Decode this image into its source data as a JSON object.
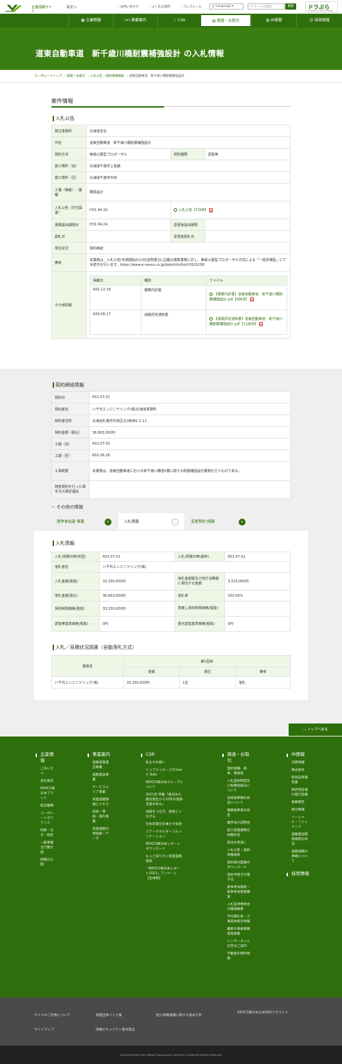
{
  "header": {
    "logo_alt": "NEXCO",
    "logo_sub": "東日本",
    "site_label": "企業情報サイト",
    "back_link": "本文へ",
    "utility": [
      {
        "label": "お問い合わせ"
      },
      {
        "label": "よくある質問"
      },
      {
        "label": "プレスルーム"
      }
    ],
    "language": "Language",
    "search_placeholder": "サイト内検索",
    "search_button": "検索",
    "drapura": "ドラぷら",
    "drapura_sub": "E-NEXCO Drive Plaza"
  },
  "nav": [
    {
      "label": "企業情報"
    },
    {
      "label": "事業案内"
    },
    {
      "label": "CSR"
    },
    {
      "label": "調達・お取引"
    },
    {
      "label": "IR情報"
    },
    {
      "label": "採用情報"
    }
  ],
  "hero_title": "道東自動車道　新千歳川橋耐震補強設計 の入札情報",
  "breadcrumb": [
    "コーポレートトップ",
    "調達・お取引",
    "入札公告・契約情報検索",
    "道東自動車道　新千歳川橋耐震補強設計"
  ],
  "section_title": "案件情報",
  "notice": {
    "title": "入札公告",
    "rows": {
      "issuer_label": "発注事務所",
      "issuer": "北海道支社",
      "subject_label": "件名",
      "subject": "道東自動車道　新千歳川橋耐震補強設計",
      "method_label": "契約方法",
      "method": "簡易公募型プロポーザル",
      "type_label": "契約種類",
      "type": "調査等",
      "place_from_label": "施工場所（自）",
      "place_from": "北海道千歳市上長都",
      "place_to_label": "施工場所（至）",
      "place_to": "北海道千歳市中央",
      "work_label": "工種（等級）／業種",
      "work": "橋梁設計",
      "pub_label": "入札公告（交付図書）",
      "pub_date": "H31.04.10",
      "pub_file": "入札公告【72KB】",
      "doc_deadline_label": "書類提出期限日",
      "doc_deadline": "H31.04.24",
      "change_submit_label": "変更後提出期限",
      "change_submit": "",
      "open_label": "開札日",
      "open": "",
      "change_open_label": "変更後開札日",
      "change_open": "",
      "status_label": "現在状況",
      "status": "契約締結",
      "remarks_label": "備考",
      "remarks": "本業務は、入札公告(手続開始の公示[説明書])に記載の複数業務に対し、簡易公募型プロポーザル方式による「一括評価型」にて手続きを行います。https://www.e-nexco.co.jp/bids/info/list/h31/0228/",
      "other_label": "その他情報"
    },
    "other": {
      "headers": [
        "掲載日",
        "種別",
        "ファイル"
      ],
      "rows": [
        {
          "date": "R02.12.18",
          "kind": "積算内訳書",
          "file": "【積算内訳書】道東自動車道　新千歳川橋耐震補強設計.pdf【98KB】"
        },
        {
          "date": "R03.06.17",
          "kind": "成績評定通知書",
          "file": "【成績評定通知書】道東自動車道　新千歳川橋耐震補強設計.pdf【118KB】"
        }
      ]
    }
  },
  "contract": {
    "title": "契約締結情報",
    "rows": [
      {
        "label": "契約日",
        "value": "R01.07.01"
      },
      {
        "label": "契約者名",
        "value": "八千代エンジニヤリング(株)北海道事務所"
      },
      {
        "label": "契約者住所",
        "value": "北海道札幌市中央区北3条西1-1-11"
      },
      {
        "label": "契約金額（税込）",
        "value": "36,663,000円"
      },
      {
        "label": "工期（自）",
        "value": "R01.07.03"
      },
      {
        "label": "工期（至）",
        "value": "R02.06.26"
      },
      {
        "label": "工事概要",
        "value": "本業務は、道東自動車道における新千歳川橋他1橋に関する耐震補強設計業務を行うものである。"
      },
      {
        "label": "随意契約を行った相手方の選定理由",
        "value": ""
      }
    ]
  },
  "other_info_title": "その他の情報",
  "tabs": [
    {
      "label": "競争参加者 情報",
      "icon": "+"
    },
    {
      "label": "入札情報",
      "icon": "−"
    },
    {
      "label": "変更契約 情報",
      "icon": "+"
    }
  ],
  "bid": {
    "title": "入札情報",
    "rows": [
      {
        "l1": "入札/見積日時(初回)",
        "v1": "R01.07.01",
        "l2": "入札/見積日時(最終)",
        "v2": "R01.07.01"
      },
      {
        "l1": "落札者名",
        "v1": "八千代エンジニヤリング(株)"
      },
      {
        "l1": "入札金額(税抜)",
        "v1": "33,330,000円",
        "l2": "落札金額税及び地方消費税に相当する金額",
        "v2": "3,333,000円"
      },
      {
        "l1": "落札金額(税込)",
        "v1": "36,663,000円",
        "l2": "落札率",
        "v2": "100.00%"
      },
      {
        "l1": "契約制限価格(税抜)",
        "v1": "33,330,000円",
        "l2": "意義し契約制限価格(税抜)",
        "v2": ""
      },
      {
        "l1": "調査等基準価格(税抜)",
        "v1": "0円",
        "l2": "重点調査基準価格(税抜)",
        "v2": "0円"
      }
    ]
  },
  "bid_table": {
    "title": "入札／見積状況調書（自動落札方式）",
    "round": "第1回目",
    "headers": [
      "業者名",
      "金額",
      "順位",
      "備考"
    ],
    "rows": [
      {
        "name": "八千代エンジニヤリング(株)",
        "amount": "33,330,000円",
        "rank": "1位",
        "note": "落札"
      }
    ]
  },
  "to_top": "トップへ戻る",
  "footer": {
    "cols": [
      {
        "title": "企業情報",
        "items": [
          "ごあいさつ",
          "会社案内",
          "NEXCO東日本ブランド",
          "経営戦略",
          "コーポレートガバナンス",
          "約款・法令・指定",
          "一般事業主行動計画",
          "情報の公開"
        ]
      },
      {
        "title": "事業案内",
        "items": [
          "道路管理運営事業",
          "道路建設事業",
          "サービスエリア事業",
          "高速道路関連ビジネス",
          "技術・環境・海外事業",
          "高速道路の用語集・データ"
        ]
      },
      {
        "title": "CSR",
        "items": [
          "私たちの想い",
          "トップメッセージ(Cross × Talk)",
          "NEXCO東日本グループについて",
          "2021年 特集「東日本大震災発生から10年の復興支援の歩み」",
          "地域をつなぎ、地域とつながる",
          "社会的責任を果たす役割",
          "ステークホルダーコミュニケーション",
          "NEXCO東日本レポートダウンロード",
          "もっと知りたい高速道路部長",
          "「NEXCO東日本レポート2021」アンケート【全体版】"
        ]
      },
      {
        "title": "調達・お取引",
        "items": [
          "契約情報、基準、要領等",
          "入札契約制度及び各種取組みについて",
          "技術基準類の改定について",
          "積算基準等の改定",
          "業界向け説明会",
          "施工管理業務の依頼状況",
          "発注の見通し",
          "入札公告・契約情報検索",
          "契約検討図書のダウンロード",
          "契約手続きの電子化",
          "競争参加資格・競争参加資格審査",
          "入札監視委員会の審議概要",
          "平均落札率・工事契約統計情報",
          "最新の事故事業実践事業",
          "インターネット広告のご案内",
          "不動産の物件情報"
        ]
      },
      {
        "title": "IR情報",
        "items": [
          "決算情報",
          "株主総会",
          "有価証券報告書",
          "政府保証債の発行実績",
          "事業報告",
          "格付情報",
          "ソーシャル・ファイナンス",
          "道路建設関係債務の状況",
          "道路債務の承継について"
        ]
      },
      {
        "title": "採用情報",
        "items": []
      }
    ]
  },
  "footer2": {
    "links": [
      "サイトのご利用について",
      "関連団体リンク集",
      "個人情報保護に関する基本方針",
      "サイトマップ",
      "情報セキュリティ基本理念"
    ],
    "sns": "NEXCO東日本公式SNSアカウント"
  },
  "copyright": "Copyright2020 East Nippon Expressway Company Limited All Rights Reserved."
}
